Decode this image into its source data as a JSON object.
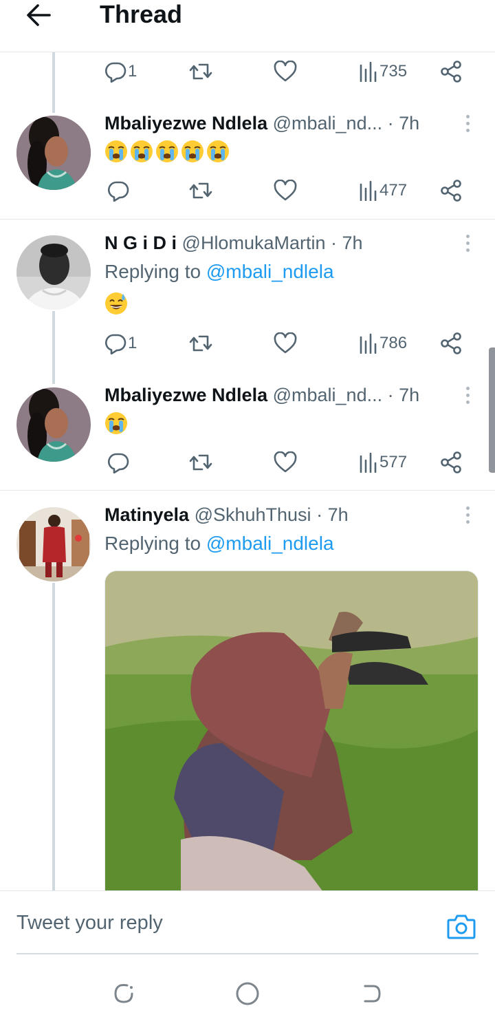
{
  "header": {
    "title": "Thread",
    "back_icon": "arrow-left-icon"
  },
  "tweets": [
    {
      "actions": {
        "reply_count": "1",
        "retweet_count": "",
        "like_count": "",
        "views": "735"
      }
    },
    {
      "name": "Mbaliyezwe Ndlela",
      "handle": "@mbali_nd...",
      "time": "· 7h",
      "emojis": [
        "😭",
        "😭",
        "😭",
        "😭",
        "😭"
      ],
      "actions": {
        "reply_count": "",
        "views": "477"
      }
    },
    {
      "name": "N G i D i",
      "handle": "@HlomukaMartin",
      "time": "· 7h",
      "replying_prefix": "Replying to",
      "replying_handle": "@mbali_ndlela",
      "emojis": [
        "😅"
      ],
      "actions": {
        "reply_count": "1",
        "views": "786"
      }
    },
    {
      "name": "Mbaliyezwe Ndlela",
      "handle": "@mbali_nd...",
      "time": "· 7h",
      "emojis": [
        "😭"
      ],
      "actions": {
        "reply_count": "",
        "views": "577"
      }
    },
    {
      "name": "Matinyela",
      "handle": "@SkhuhThusi",
      "time": "· 7h",
      "replying_prefix": "Replying to",
      "replying_handle": "@mbali_ndlela"
    }
  ],
  "reply_bar": {
    "placeholder": "Tweet your reply"
  },
  "colors": {
    "accent": "#1d9bf0",
    "muted": "#536471",
    "thread_line": "#cfd9de"
  }
}
